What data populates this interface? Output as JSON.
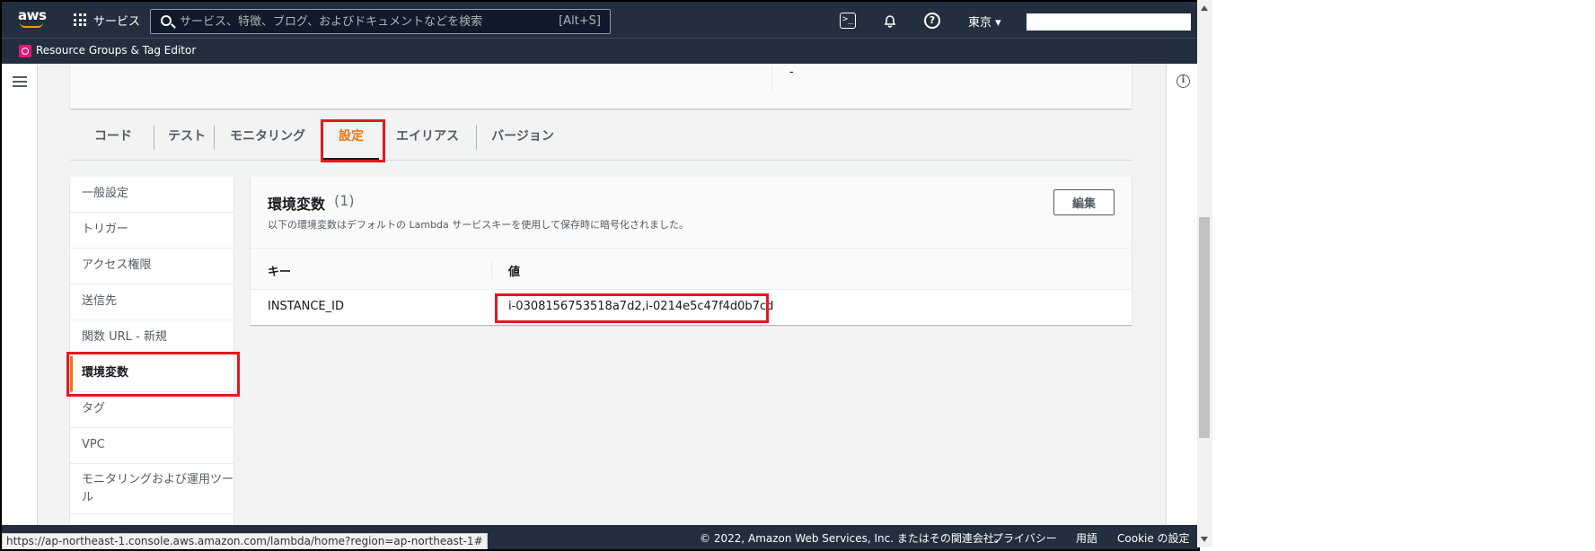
{
  "nav": {
    "services_label": "サービス",
    "search_placeholder": "サービス、特徴、ブログ、およびドキュメントなどを検索",
    "search_shortcut": "[Alt+S]",
    "region_label": "東京 ▾"
  },
  "service_bar": {
    "label": "Resource Groups & Tag Editor"
  },
  "top_card": {
    "value": "-"
  },
  "tabs": [
    {
      "label": "コード"
    },
    {
      "label": "テスト"
    },
    {
      "label": "モニタリング"
    },
    {
      "label": "設定",
      "active": true
    },
    {
      "label": "エイリアス"
    },
    {
      "label": "バージョン"
    }
  ],
  "side_menu": [
    {
      "label": "一般設定"
    },
    {
      "label": "トリガー"
    },
    {
      "label": "アクセス権限"
    },
    {
      "label": "送信先"
    },
    {
      "label": "関数 URL - 新規"
    },
    {
      "label": "環境変数",
      "active": true
    },
    {
      "label": "タグ"
    },
    {
      "label": "VPC"
    },
    {
      "label": "モニタリングおよび運用ツール"
    }
  ],
  "env": {
    "title": "環境変数",
    "count": "(1)",
    "description": "以下の環境変数はデフォルトの Lambda サービスキーを使用して保存時に暗号化されました。",
    "edit_label": "編集",
    "columns": [
      "キー",
      "値"
    ],
    "rows": [
      {
        "key": "INSTANCE_ID",
        "value": "i-0308156753518a7d2,i-0214e5c47f4d0b7cd"
      }
    ]
  },
  "footer": {
    "copyright": "© 2022, Amazon Web Services, Inc. またはその関連会社。",
    "privacy": "プライバシー",
    "terms": "用語",
    "cookie": "Cookie の設定"
  },
  "status_url": "https://ap-northeast-1.console.aws.amazon.com/lambda/home?region=ap-northeast-1#",
  "colors": {
    "nav_bg": "#232f3e",
    "accent": "#ec7211",
    "highlight": "#e3191f"
  }
}
